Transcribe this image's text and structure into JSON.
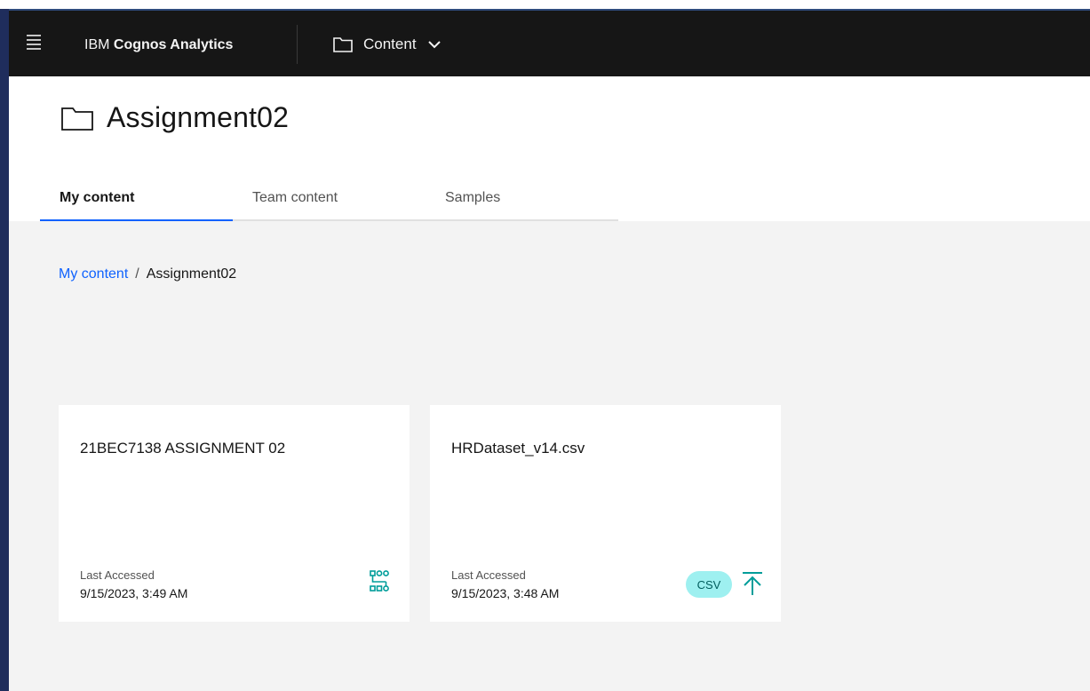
{
  "topbar": {
    "brand_prefix": "IBM",
    "brand_name": "Cognos Analytics",
    "switcher_label": "Content"
  },
  "page": {
    "title": "Assignment02"
  },
  "tabs": [
    {
      "label": "My content",
      "active": true
    },
    {
      "label": "Team content",
      "active": false
    },
    {
      "label": "Samples",
      "active": false
    }
  ],
  "breadcrumb": {
    "root": "My content",
    "separator": "/",
    "current": "Assignment02"
  },
  "cards": [
    {
      "title": "21BEC7138 ASSIGNMENT 02",
      "meta_label": "Last Accessed",
      "meta_value": "9/15/2023, 3:49 AM",
      "icon": "data-module-icon"
    },
    {
      "title": "HRDataset_v14.csv",
      "meta_label": "Last Accessed",
      "meta_value": "9/15/2023, 3:48 AM",
      "badge": "CSV",
      "icon": "upload-icon"
    }
  ],
  "colors": {
    "topbar_bg": "#161616",
    "accent_blue": "#0f62fe",
    "teal": "#009d9a",
    "csv_badge_bg": "#9ef0f0",
    "content_bg": "#f3f3f3"
  }
}
